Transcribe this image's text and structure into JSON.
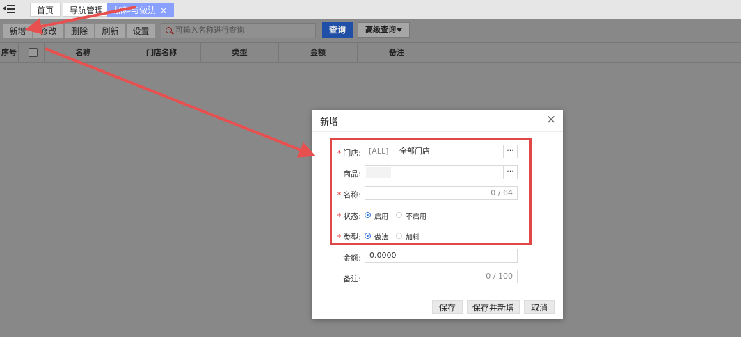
{
  "tabs": [
    {
      "label": "首页"
    },
    {
      "label": "导航管理"
    },
    {
      "label": "加料与做法",
      "close": "×"
    }
  ],
  "toolbar": {
    "add": "新增",
    "edit": "修改",
    "delete": "删除",
    "refresh": "刷新",
    "settings": "设置",
    "search_placeholder": "可输入名称进行查询",
    "query": "查询",
    "advanced": "高级查询"
  },
  "table": {
    "headers": [
      "序号",
      "名称",
      "门店名称",
      "类型",
      "金额",
      "备注"
    ]
  },
  "dialog": {
    "title": "新增",
    "close": "×",
    "store_label": "门店",
    "store_code": "[ALL]",
    "store_name": "全部门店",
    "goods_label": "商品",
    "name_label": "名称",
    "name_counter": "0 / 64",
    "status_label": "状态",
    "status_options": [
      "启用",
      "不启用"
    ],
    "type_label": "类型",
    "type_options": [
      "做法",
      "加料"
    ],
    "amount_label": "金额",
    "amount_value": "0.0000",
    "remark_label": "备注",
    "remark_counter": "0 / 100",
    "ellipsis": "···",
    "save": "保存",
    "save_new": "保存并新增",
    "cancel": "取消"
  },
  "colors": {
    "accent": "#2b6fde",
    "highlight": "#e04848",
    "active_tab": "#8aa0ff"
  }
}
